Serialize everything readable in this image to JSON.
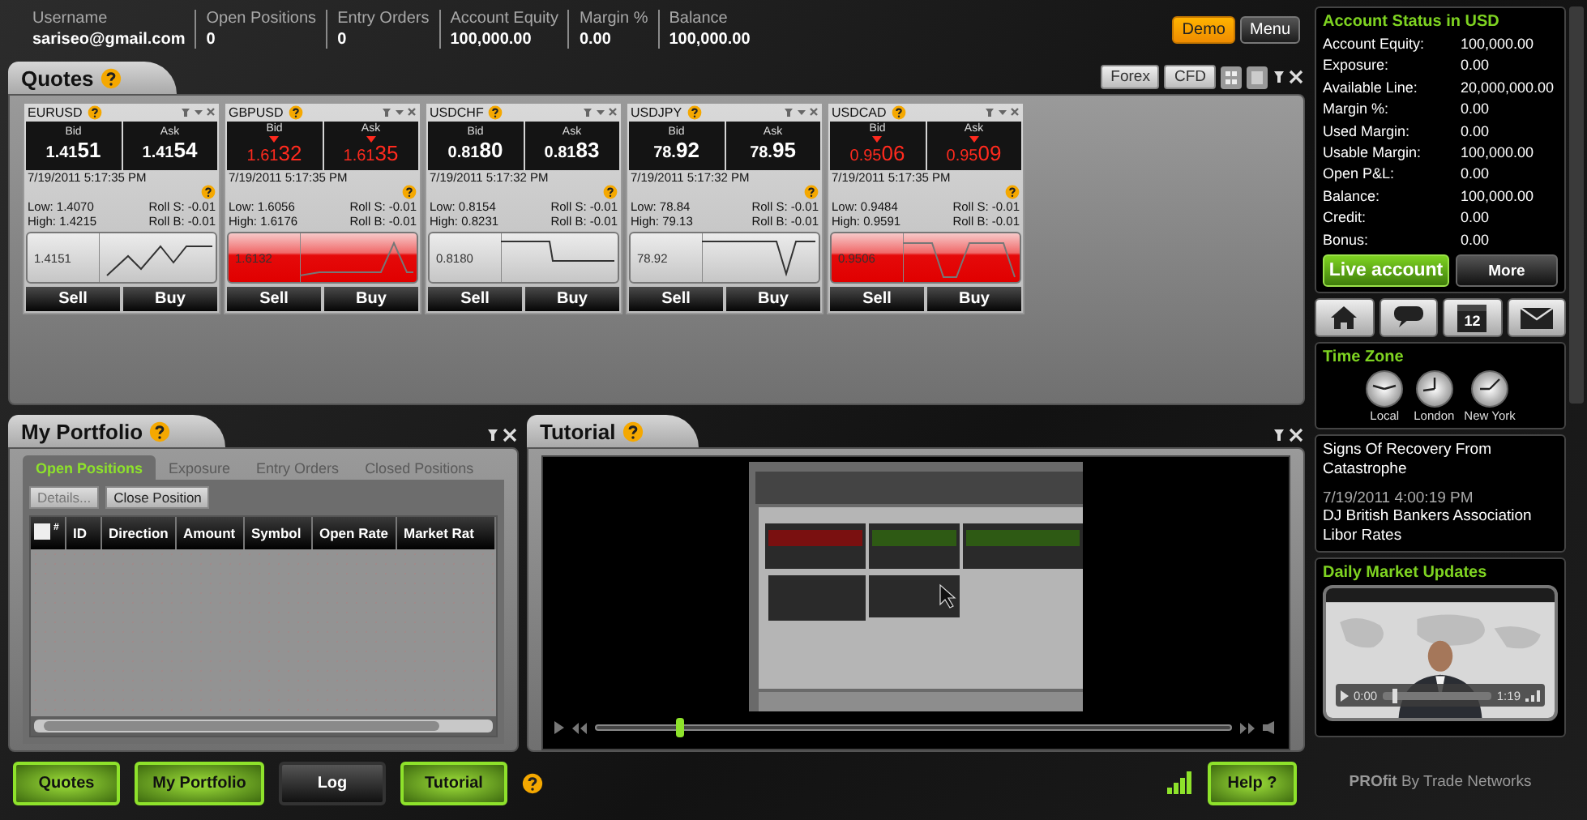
{
  "top_bar": {
    "fields": [
      {
        "label": "Username",
        "value": "sariseo@gmail.com"
      },
      {
        "label": "Open Positions",
        "value": "0"
      },
      {
        "label": "Entry Orders",
        "value": "0"
      },
      {
        "label": "Account Equity",
        "value": "100,000.00"
      },
      {
        "label": "Margin %",
        "value": "0.00"
      },
      {
        "label": "Balance",
        "value": "100,000.00"
      }
    ],
    "buttons": [
      {
        "label": "Demo",
        "selected": true
      },
      {
        "label": "Menu",
        "selected": false
      }
    ]
  },
  "quotes": {
    "title": "Quotes",
    "filters": [
      {
        "label": "Forex"
      },
      {
        "label": "CFD"
      }
    ],
    "cards": [
      {
        "symbol": "EURUSD",
        "bid_label": "Bid",
        "ask_label": "Ask",
        "bid": "1.4151",
        "ask": "1.4154",
        "falling": false,
        "time": "7/19/2011 5:17:35 PM",
        "low": "Low: 1.4070",
        "high": "High: 1.4215",
        "roll_s": "Roll S: -0.01",
        "roll_b": "Roll B: -0.01",
        "chart_label": "1.4151",
        "sell": "Sell",
        "buy": "Buy"
      },
      {
        "symbol": "GBPUSD",
        "bid_label": "Bid",
        "ask_label": "Ask",
        "bid": "1.6132",
        "ask": "1.6135",
        "falling": true,
        "time": "7/19/2011 5:17:35 PM",
        "low": "Low: 1.6056",
        "high": "High: 1.6176",
        "roll_s": "Roll S: -0.01",
        "roll_b": "Roll B: -0.01",
        "chart_label": "1.6132",
        "sell": "Sell",
        "buy": "Buy"
      },
      {
        "symbol": "USDCHF",
        "bid_label": "Bid",
        "ask_label": "Ask",
        "bid": "0.8180",
        "ask": "0.8183",
        "falling": false,
        "time": "7/19/2011 5:17:32 PM",
        "low": "Low: 0.8154",
        "high": "High: 0.8231",
        "roll_s": "Roll S: -0.01",
        "roll_b": "Roll B: -0.01",
        "chart_label": "0.8180",
        "sell": "Sell",
        "buy": "Buy"
      },
      {
        "symbol": "USDJPY",
        "bid_label": "Bid",
        "ask_label": "Ask",
        "bid": "78.92",
        "ask": "78.95",
        "falling": false,
        "time": "7/19/2011 5:17:32 PM",
        "low": "Low: 78.84",
        "high": "High: 79.13",
        "roll_s": "Roll S: -0.01",
        "roll_b": "Roll B: -0.01",
        "chart_label": "78.92",
        "sell": "Sell",
        "buy": "Buy"
      },
      {
        "symbol": "USDCAD",
        "bid_label": "Bid",
        "ask_label": "Ask",
        "bid": "0.9506",
        "ask": "0.9509",
        "falling": true,
        "time": "7/19/2011 5:17:35 PM",
        "low": "Low: 0.9484",
        "high": "High: 0.9591",
        "roll_s": "Roll S: -0.01",
        "roll_b": "Roll B: -0.01",
        "chart_label": "0.9506",
        "sell": "Sell",
        "buy": "Buy"
      }
    ]
  },
  "portfolio": {
    "title": "My Portfolio",
    "tabs": [
      {
        "label": "Open Positions",
        "selected": true
      },
      {
        "label": "Exposure",
        "selected": false
      },
      {
        "label": "Entry Orders",
        "selected": false
      },
      {
        "label": "Closed Positions",
        "selected": false
      }
    ],
    "actions": [
      {
        "label": "Details...",
        "disabled": true
      },
      {
        "label": "Close Position",
        "disabled": false
      }
    ],
    "select_all": {
      "mark": "#",
      "checked": false
    },
    "columns": [
      "ID",
      "Direction",
      "Amount",
      "Symbol",
      "Open Rate",
      "Market Rat"
    ]
  },
  "tutorial": {
    "title": "Tutorial",
    "video": {
      "kind": "picture",
      "level": 0.13
    }
  },
  "nav": [
    {
      "label": "Quotes",
      "on": true
    },
    {
      "label": "My Portfolio",
      "on": true
    },
    {
      "label": "Log",
      "on": false
    },
    {
      "label": "Tutorial",
      "on": true
    }
  ],
  "help_button": "Help ?",
  "account": {
    "title": "Account Status in USD",
    "rows": [
      {
        "label": "Account Equity:",
        "value": "100,000.00"
      },
      {
        "label": "Exposure:",
        "value": "0.00"
      },
      {
        "label": "Available Line:",
        "value": "20,000,000.00"
      },
      {
        "label": "Margin %:",
        "value": "0.00"
      },
      {
        "label": "Used Margin:",
        "value": "0.00"
      },
      {
        "label": "Usable Margin:",
        "value": "100,000.00"
      },
      {
        "label": "Open P&L:",
        "value": "0.00"
      },
      {
        "label": "Balance:",
        "value": "100,000.00"
      },
      {
        "label": "Credit:",
        "value": "0.00"
      },
      {
        "label": "Bonus:",
        "value": "0.00"
      }
    ],
    "buttons": [
      {
        "label": "Live account",
        "kind": "primary"
      },
      {
        "label": "More",
        "kind": "secondary"
      }
    ]
  },
  "shortcuts": [
    {
      "kind": "home"
    },
    {
      "kind": "chat"
    },
    {
      "kind": "calendar",
      "day": "12"
    },
    {
      "kind": "mail"
    }
  ],
  "time_zone": {
    "title": "Time Zone",
    "clocks": [
      {
        "label": "Local"
      },
      {
        "label": "London"
      },
      {
        "label": "New York"
      }
    ]
  },
  "news": [
    {
      "headline": "Signs Of Recovery From Catastrophe"
    },
    {
      "time": "7/19/2011 4:00:19 PM",
      "headline": "DJ British Bankers Association Libor Rates"
    }
  ],
  "daily": {
    "title": "Daily Market Updates",
    "elapsed": "0:00",
    "duration": "1:19",
    "level": 0.1
  },
  "footer": "**PROfit** By Trade Networks"
}
